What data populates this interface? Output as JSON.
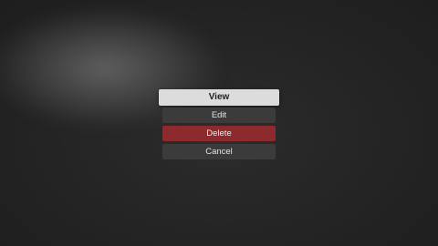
{
  "menu": {
    "items": [
      {
        "label": "View",
        "state": "focused"
      },
      {
        "label": "Edit",
        "state": "normal"
      },
      {
        "label": "Delete",
        "state": "destructive"
      },
      {
        "label": "Cancel",
        "state": "normal"
      }
    ]
  },
  "colors": {
    "background": "#242424",
    "focused_item": "#dcdcdc",
    "normal_item": "#3b3b3b",
    "destructive_item": "#8c2a2e"
  }
}
